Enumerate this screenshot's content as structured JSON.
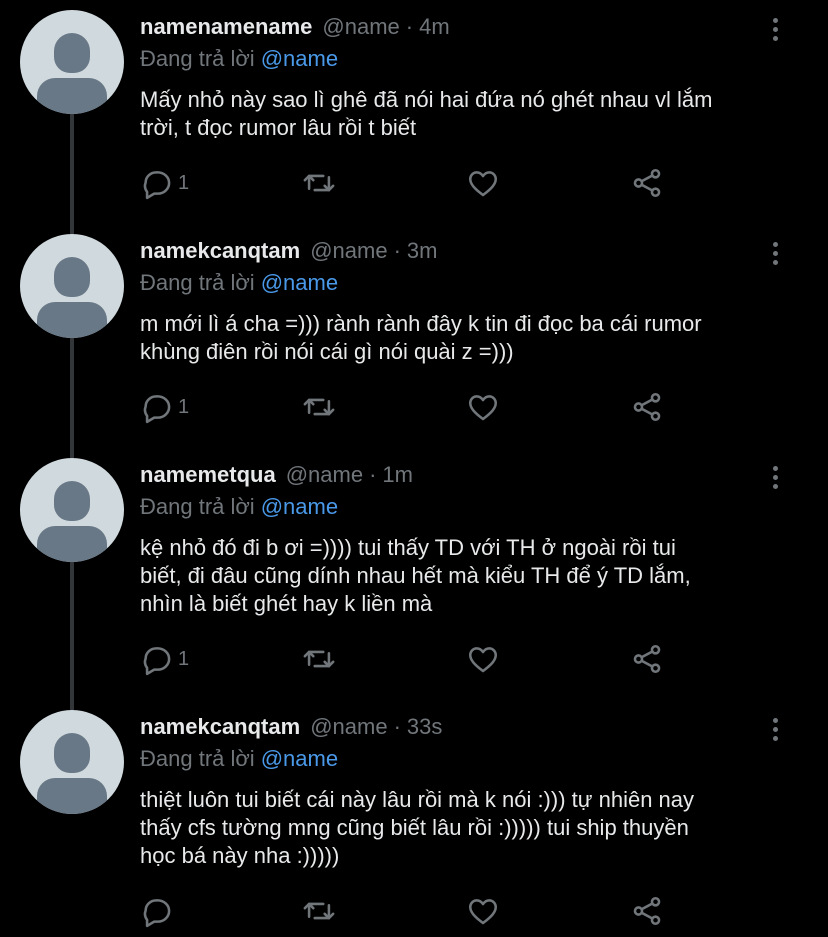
{
  "colors": {
    "background": "#000000",
    "text": "#e7e9ea",
    "muted": "#71767b",
    "mention": "#4a99e9",
    "avatar_bg": "#cfd9de",
    "avatar_fg": "#697886"
  },
  "replies": [
    {
      "name": "namenamename",
      "handle": "@name",
      "separator": "·",
      "time": "4m",
      "replying_label": "Đang trả lời",
      "replying_to": "@name",
      "lines": [
        "Mấy nhỏ này sao lì ghê đã nói hai đứa nó ghét nhau vl lắm",
        "trời, t đọc rumor lâu rồi t biết"
      ],
      "reply_count": "1",
      "icons": [
        "reply-icon",
        "retweet-icon",
        "like-icon",
        "share-icon"
      ]
    },
    {
      "name": "namekcanqtam",
      "handle": "@name",
      "separator": "·",
      "time": "3m",
      "replying_label": "Đang trả lời",
      "replying_to": "@name",
      "lines": [
        "m mới lì á cha =))) rành rành đây k tin đi đọc ba cái rumor",
        "khùng điên rồi nói cái gì nói quài z =)))"
      ],
      "reply_count": "1",
      "icons": [
        "reply-icon",
        "retweet-icon",
        "like-icon",
        "share-icon"
      ]
    },
    {
      "name": "namemetqua",
      "handle": "@name",
      "separator": "·",
      "time": "1m",
      "replying_label": "Đang trả lời",
      "replying_to": "@name",
      "lines": [
        "kệ nhỏ đó đi b ơi =)))) tui thấy TD với TH ở ngoài rồi tui",
        "biết, đi đâu cũng dính nhau hết mà kiểu TH để ý TD lắm,",
        "nhìn là biết ghét hay k liền mà"
      ],
      "reply_count": "1",
      "icons": [
        "reply-icon",
        "retweet-icon",
        "like-icon",
        "share-icon"
      ]
    },
    {
      "name": "namekcanqtam",
      "handle": "@name",
      "separator": "·",
      "time": "33s",
      "replying_label": "Đang trả lời",
      "replying_to": "@name",
      "lines": [
        "thiệt luôn tui biết cái này lâu rồi mà k nói :))) tự nhiên nay",
        "thấy cfs tường mng cũng biết lâu rồi :))))) tui ship thuyền",
        "học bá này nha :)))))"
      ],
      "reply_count": "",
      "icons": [
        "reply-icon",
        "retweet-icon",
        "like-icon",
        "share-icon"
      ]
    }
  ]
}
